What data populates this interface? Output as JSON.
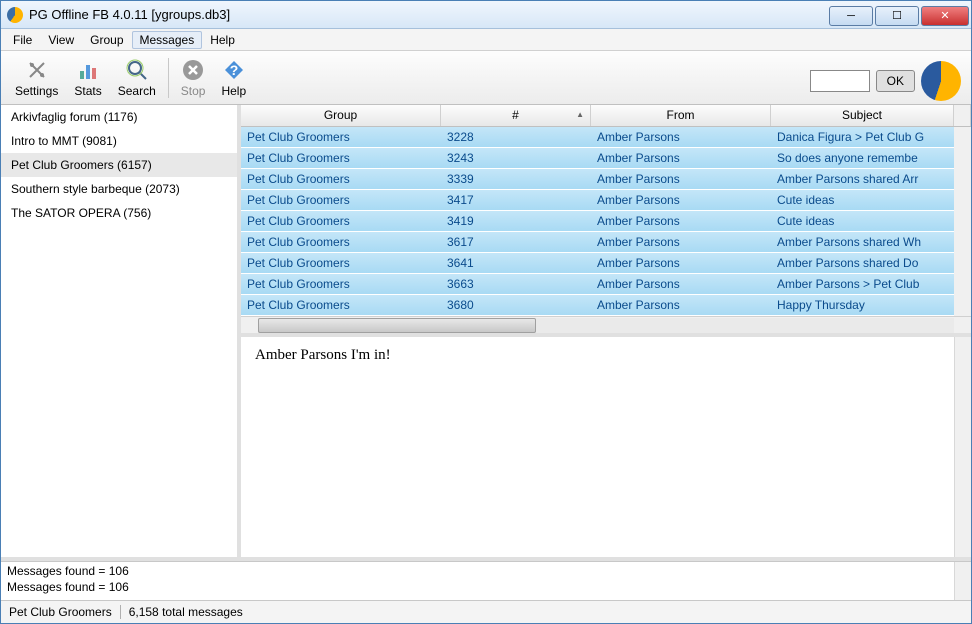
{
  "title": "PG Offline FB 4.0.11  [ygroups.db3]",
  "menu": [
    "File",
    "View",
    "Group",
    "Messages",
    "Help"
  ],
  "menu_active_index": 3,
  "toolbar": {
    "settings": "Settings",
    "stats": "Stats",
    "search": "Search",
    "stop": "Stop",
    "help": "Help",
    "ok": "OK"
  },
  "groups": [
    {
      "label": "Arkivfaglig forum (1176)",
      "selected": false
    },
    {
      "label": "Intro to MMT (9081)",
      "selected": false
    },
    {
      "label": "Pet Club Groomers (6157)",
      "selected": true
    },
    {
      "label": "Southern style barbeque (2073)",
      "selected": false
    },
    {
      "label": "The SATOR OPERA (756)",
      "selected": false
    }
  ],
  "columns": {
    "group": "Group",
    "num": "#",
    "from": "From",
    "subject": "Subject"
  },
  "sorted_column": "num",
  "rows": [
    {
      "group": "Pet Club Groomers",
      "num": "3228",
      "from": "Amber Parsons",
      "subject": "Danica Figura > Pet Club G"
    },
    {
      "group": "Pet Club Groomers",
      "num": "3243",
      "from": "Amber Parsons",
      "subject": "So does anyone remembe"
    },
    {
      "group": "Pet Club Groomers",
      "num": "3339",
      "from": "Amber Parsons",
      "subject": "Amber Parsons shared Arr"
    },
    {
      "group": "Pet Club Groomers",
      "num": "3417",
      "from": "Amber Parsons",
      "subject": "Cute ideas"
    },
    {
      "group": "Pet Club Groomers",
      "num": "3419",
      "from": "Amber Parsons",
      "subject": "Cute ideas"
    },
    {
      "group": "Pet Club Groomers",
      "num": "3617",
      "from": "Amber Parsons",
      "subject": "Amber Parsons shared Wh"
    },
    {
      "group": "Pet Club Groomers",
      "num": "3641",
      "from": "Amber Parsons",
      "subject": "Amber Parsons shared Do"
    },
    {
      "group": "Pet Club Groomers",
      "num": "3663",
      "from": "Amber Parsons",
      "subject": "Amber Parsons > Pet Club"
    },
    {
      "group": "Pet Club Groomers",
      "num": "3680",
      "from": "Amber Parsons",
      "subject": "Happy Thursday"
    }
  ],
  "preview": "Amber Parsons I'm in!",
  "log": [
    "Messages found = 106",
    "Messages found = 106"
  ],
  "status": {
    "group": "Pet Club Groomers",
    "total": "6,158 total messages"
  }
}
